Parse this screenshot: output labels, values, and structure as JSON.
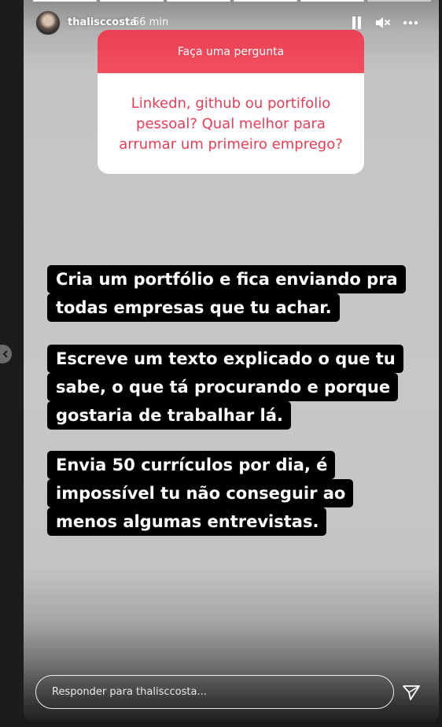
{
  "story": {
    "username": "thalisccosta",
    "time": "56 min",
    "segments": 6,
    "completed_segments": 5
  },
  "question_box": {
    "header": "Faça uma pergunta",
    "question": "Linkedn, github ou portifolio pessoal? Qual melhor para arrumar um primeiro emprego?"
  },
  "answer_blocks": [
    {
      "lines": [
        "Cria um portfólio e fica enviando pra",
        "todas empresas que tu achar."
      ]
    },
    {
      "lines": [
        "Escreve um texto explicado o que tu",
        "sabe, o que tá procurando e porque",
        "gostaria de trabalhar lá."
      ]
    },
    {
      "lines": [
        "Envia 50 currículos por dia, é",
        "impossível tu não conseguir ao",
        "menos algumas entrevistas."
      ]
    }
  ],
  "reply": {
    "placeholder": "Responder para thalisccosta..."
  },
  "icons": {
    "previous": "chevron-left-icon",
    "pause": "pause-icon",
    "mute": "speaker-muted-icon",
    "more": "more-dots-icon",
    "send": "paper-plane-icon"
  },
  "colors": {
    "question_header": "#ea4055",
    "question_text": "#e53e56",
    "text_highlight": "#000000"
  }
}
